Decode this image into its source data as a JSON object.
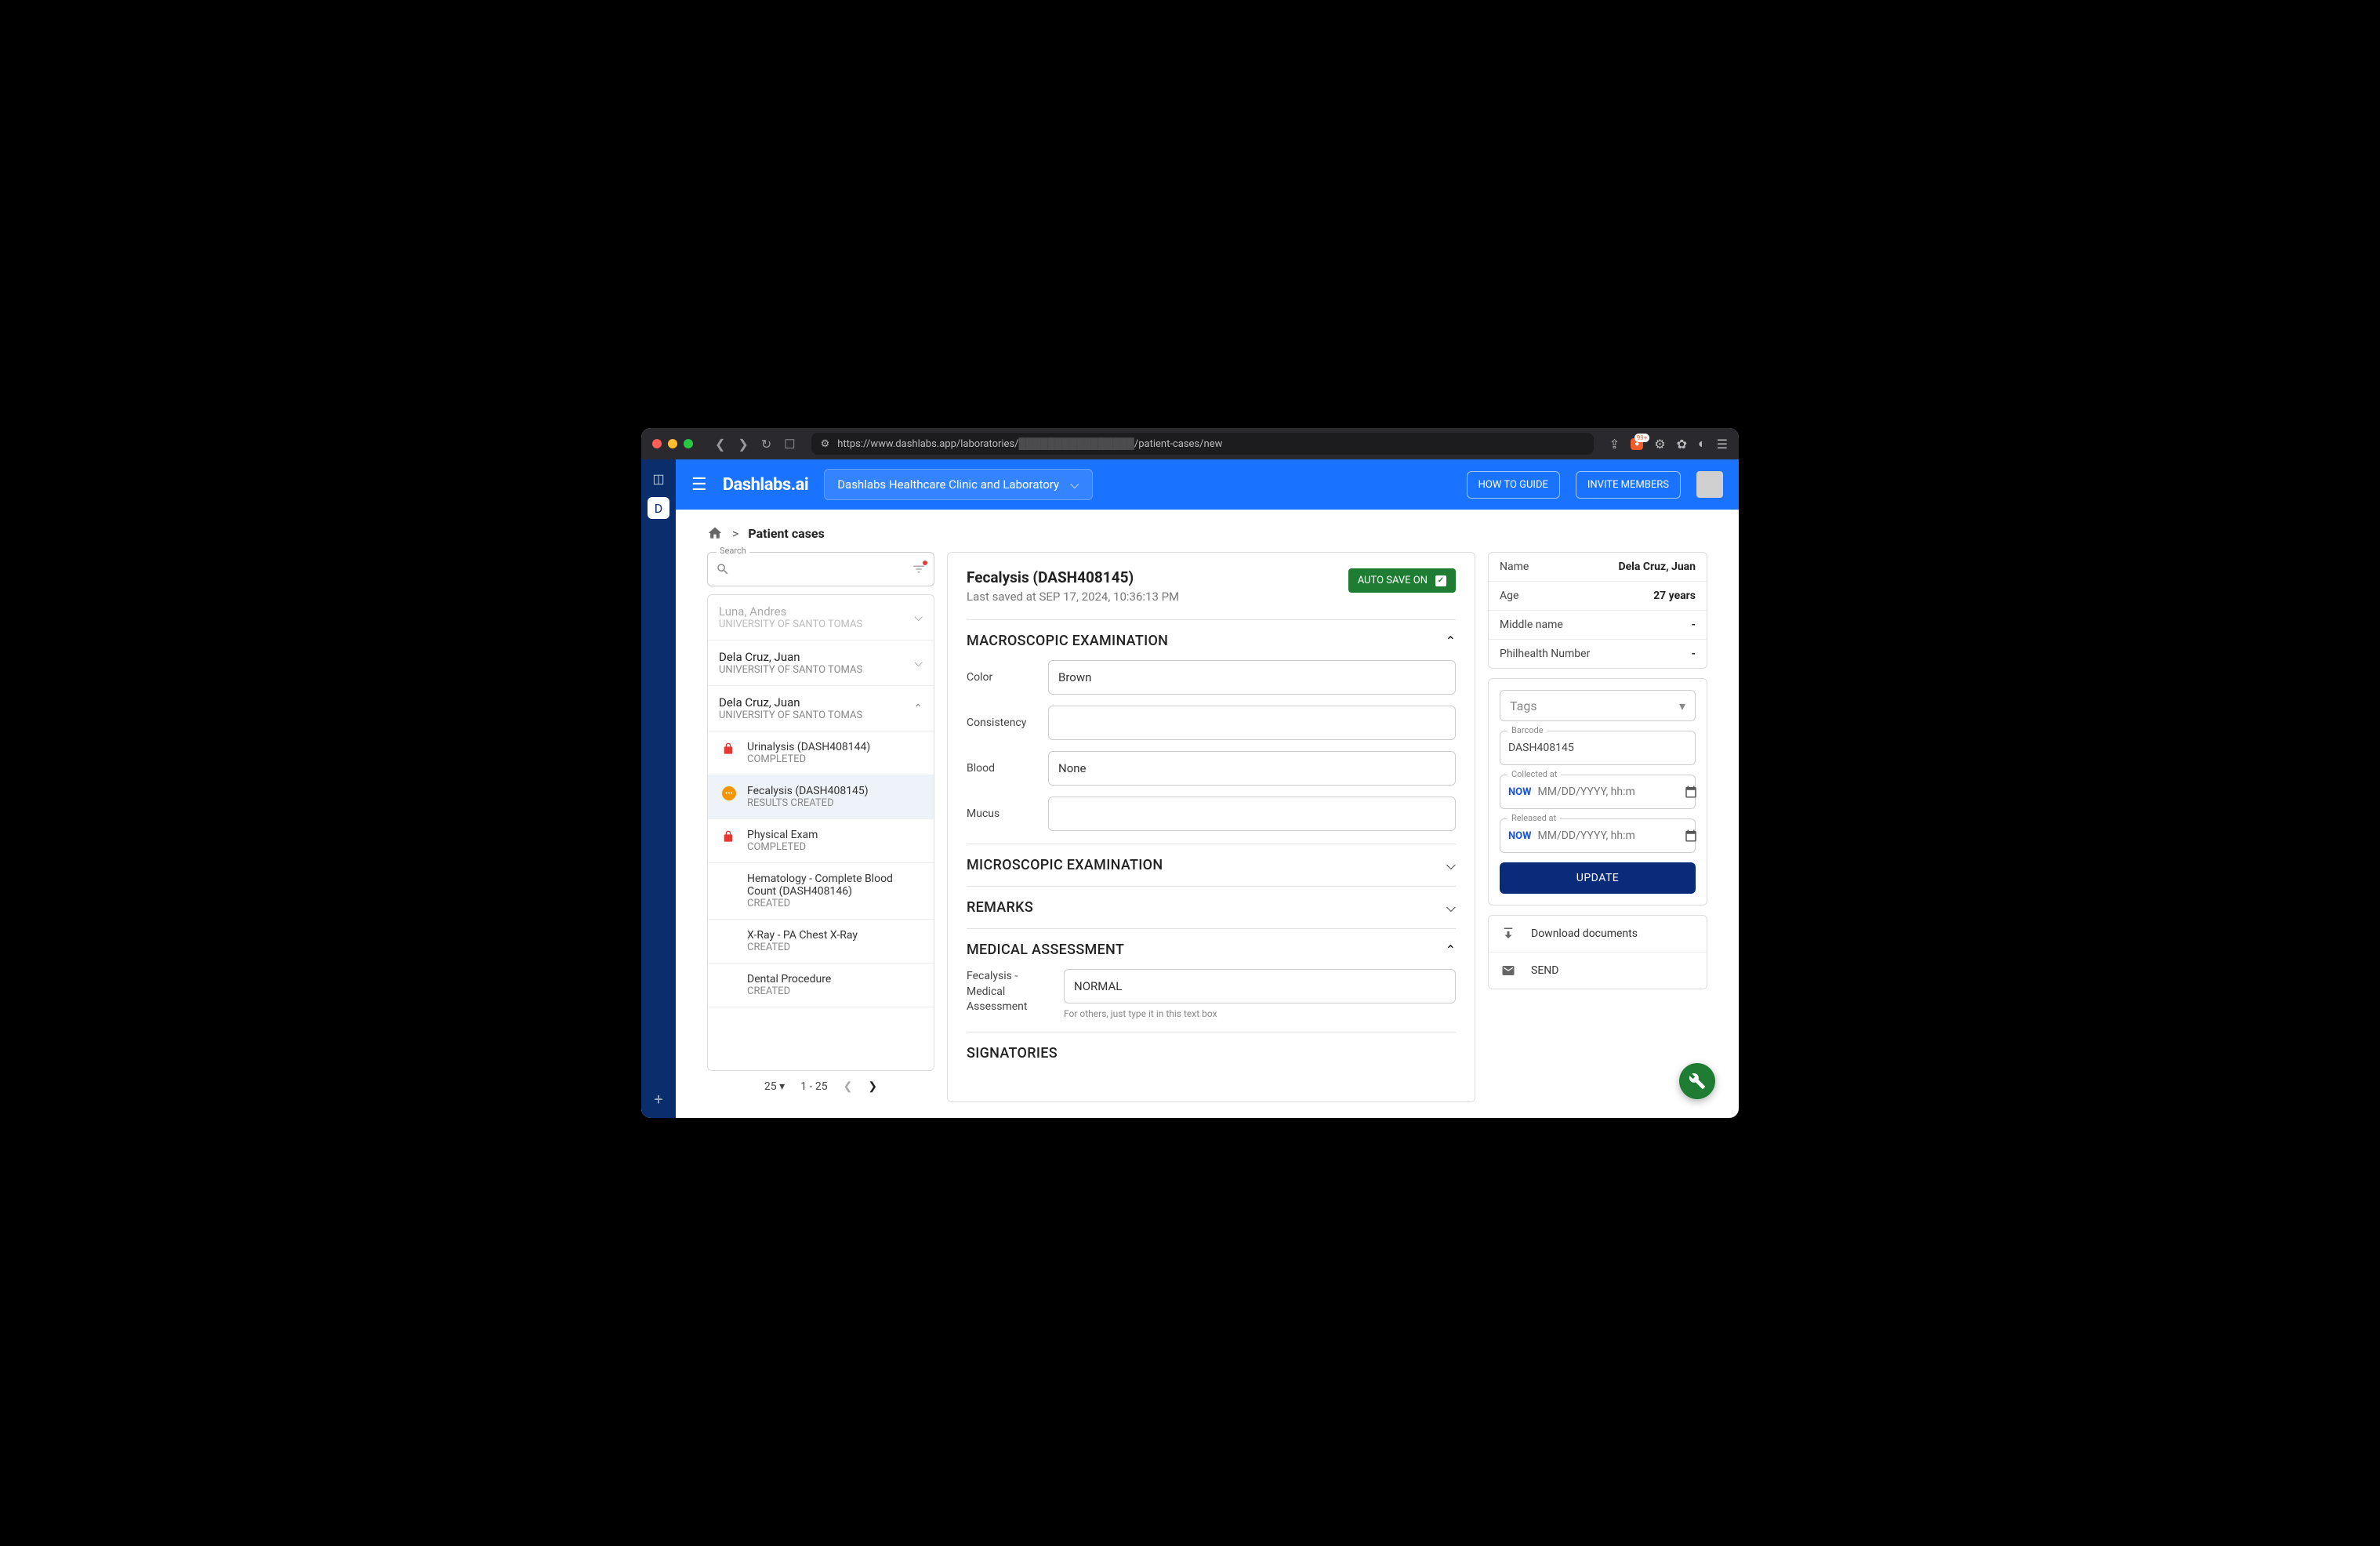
{
  "browser": {
    "url_prefix": "https://www.dashlabs.app/laboratories/",
    "url_suffix": "/patient-cases/new"
  },
  "topbar": {
    "logo": "Dashlabs.ai",
    "org": "Dashlabs Healthcare Clinic and Laboratory",
    "howto": "HOW TO GUIDE",
    "invite": "INVITE MEMBERS"
  },
  "breadcrumb": {
    "sep": ">",
    "current": "Patient cases"
  },
  "search": {
    "label": "Search",
    "placeholder": ""
  },
  "cases": [
    {
      "name": "Luna, Andres",
      "org": "UNIVERSITY OF SANTO TOMAS",
      "muted": true,
      "expanded": false
    },
    {
      "name": "Dela Cruz, Juan",
      "org": "UNIVERSITY OF SANTO TOMAS",
      "muted": false,
      "expanded": false
    },
    {
      "name": "Dela Cruz, Juan",
      "org": "UNIVERSITY OF SANTO TOMAS",
      "muted": false,
      "expanded": true
    }
  ],
  "tests": [
    {
      "icon": "lock",
      "title": "Urinalysis (DASH408144)",
      "status": "COMPLETED",
      "selected": false
    },
    {
      "icon": "dots",
      "title": "Fecalysis (DASH408145)",
      "status": "RESULTS CREATED",
      "selected": true
    },
    {
      "icon": "lock",
      "title": "Physical Exam",
      "status": "COMPLETED",
      "selected": false
    },
    {
      "icon": "",
      "title": "Hematology - Complete Blood Count (DASH408146)",
      "status": "CREATED",
      "selected": false
    },
    {
      "icon": "",
      "title": "X-Ray - PA Chest X-Ray",
      "status": "CREATED",
      "selected": false
    },
    {
      "icon": "",
      "title": "Dental Procedure",
      "status": "CREATED",
      "selected": false
    }
  ],
  "pager": {
    "size": "25",
    "range": "1 - 25"
  },
  "main": {
    "title": "Fecalysis (DASH408145)",
    "saved": "Last saved at SEP 17, 2024, 10:36:13 PM",
    "autosave": "AUTO SAVE ON",
    "sections": {
      "macro": "MACROSCOPIC EXAMINATION",
      "micro": "MICROSCOPIC EXAMINATION",
      "remarks": "REMARKS",
      "medassess": "MEDICAL ASSESSMENT",
      "sign": "SIGNATORIES"
    },
    "macro_fields": {
      "color_label": "Color",
      "color_value": "Brown",
      "consistency_label": "Consistency",
      "consistency_value": "",
      "blood_label": "Blood",
      "blood_value": "None",
      "mucus_label": "Mucus",
      "mucus_value": ""
    },
    "ma": {
      "label": "Fecalysis - Medical Assessment",
      "value": "NORMAL",
      "hint": "For others, just type it in this text box"
    }
  },
  "patient": {
    "name_label": "Name",
    "name": "Dela Cruz, Juan",
    "age_label": "Age",
    "age": "27 years",
    "mid_label": "Middle name",
    "mid": "-",
    "phil_label": "Philhealth Number",
    "phil": "-"
  },
  "right": {
    "tags": "Tags",
    "barcode_label": "Barcode",
    "barcode": "DASH408145",
    "collected_label": "Collected at",
    "released_label": "Released at",
    "now": "NOW",
    "date_ph": "MM/DD/YYYY, hh:m",
    "update": "UPDATE",
    "download": "Download documents",
    "send": "SEND"
  }
}
